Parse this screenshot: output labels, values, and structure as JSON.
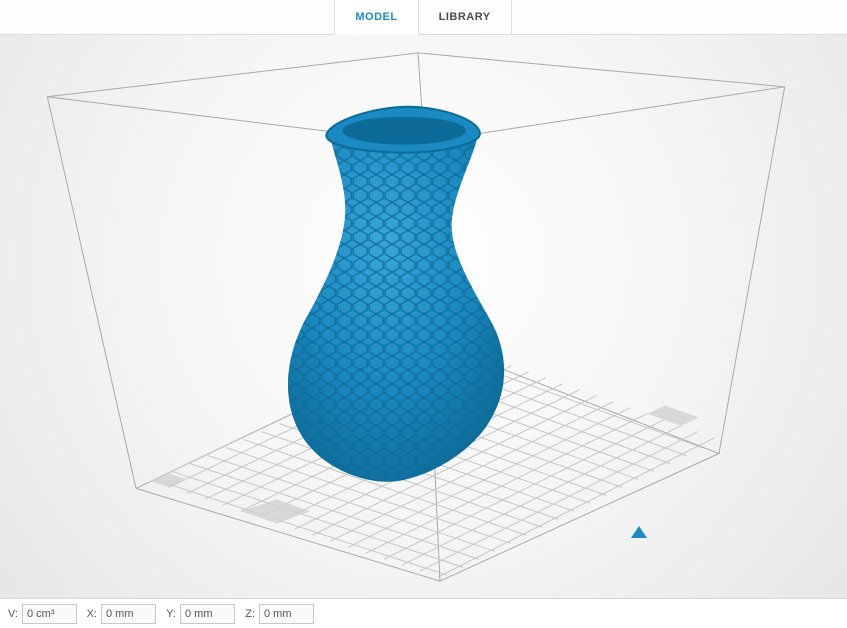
{
  "tabs": {
    "model": "MODEL",
    "library": "LIBRARY",
    "active": "model"
  },
  "viewport": {
    "model_color": "#1a8ac2",
    "grid_color": "#c5c5c5",
    "box_color": "#a8a8a8",
    "orientation_cue": "triangle"
  },
  "status": {
    "volume": {
      "label": "V:",
      "value": "0 cm³"
    },
    "x": {
      "label": "X:",
      "value": "0 mm"
    },
    "y": {
      "label": "Y:",
      "value": "0 mm"
    },
    "z": {
      "label": "Z:",
      "value": "0 mm"
    }
  }
}
